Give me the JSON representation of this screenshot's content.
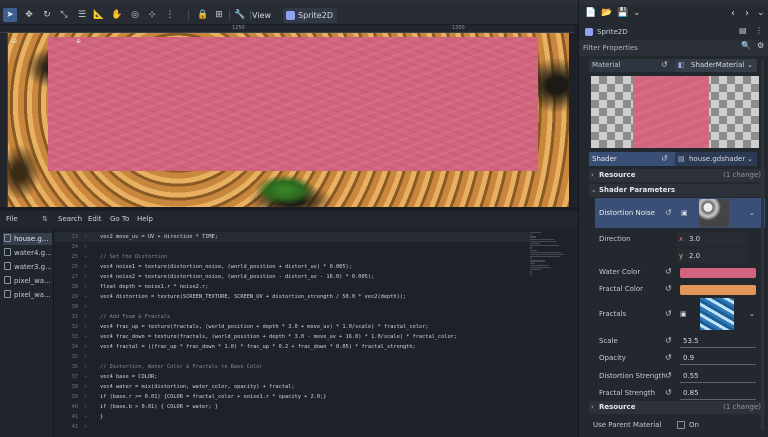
{
  "top_strip": {
    "tabs": [
      "",
      "",
      "",
      ""
    ]
  },
  "toolbar": {
    "view_label": "View",
    "node_chip": "Sprite2D"
  },
  "viewport": {
    "ruler_marks": [
      "1250",
      "1300"
    ]
  },
  "script_menu": {
    "items": [
      "File",
      "Search",
      "Edit",
      "Go To",
      "Help"
    ]
  },
  "files": [
    {
      "name": "house.g...",
      "selected": true
    },
    {
      "name": "water4.g..."
    },
    {
      "name": "water3.g..."
    },
    {
      "name": "pixel_wa..."
    },
    {
      "name": "pixel_wa..."
    }
  ],
  "code_lines": [
    {
      "n": "23",
      "text": "vec2 move_uv = UV + direction * TIME;",
      "hl": true
    },
    {
      "n": "24",
      "text": ""
    },
    {
      "n": "25",
      "text": "// Set the Distortion",
      "cmt": true
    },
    {
      "n": "26",
      "text": "vec4 noise1 = texture(distortion_noise, (world_position + distort_uv) * 0.005);"
    },
    {
      "n": "27",
      "text": "vec4 noise2 = texture(distortion_noise, (world_position - distort_uv - 16.0) * 0.005);"
    },
    {
      "n": "28",
      "text": "float depth = noise1.r * noise2.r;"
    },
    {
      "n": "29",
      "text": "vec4 distortion = texture(SCREEN_TEXTURE, SCREEN_UV + distortion_strength / 50.0 * vec2(depth));"
    },
    {
      "n": "30",
      "text": ""
    },
    {
      "n": "31",
      "text": "// Add Foam & Fractals",
      "cmt": true
    },
    {
      "n": "32",
      "text": "vec4 frac_up = texture(fractals, (world_position + depth * 3.0 + move_uv) * 1.0/scale) * fractal_color;"
    },
    {
      "n": "33",
      "text": "vec4 frac_down = texture(fractals, (world_position + depth * 3.0 - move_uv + 16.0) * 1.0/scale) * fractal_color;"
    },
    {
      "n": "34",
      "text": "vec4 fractal = ((frac_up * frac_down * 1.0) * frac_up * 0.2 + frac_down * 0.05) * fractal_strength;"
    },
    {
      "n": "35",
      "text": ""
    },
    {
      "n": "36",
      "text": "// Distortion, Water Color & Fractals to Base Color",
      "cmt": true
    },
    {
      "n": "37",
      "text": "vec4 base = COLOR;"
    },
    {
      "n": "38",
      "text": "vec4 water = mix(distortion, water_color, opacity) + fractal;"
    },
    {
      "n": "39",
      "text": "if (base.r >= 0.01) {COLOR = fractal_color + noise1.r * opacity + 2.0;}"
    },
    {
      "n": "40",
      "text": "if (base.b > 0.01) { COLOR = water; }"
    },
    {
      "n": "41",
      "text": "}"
    },
    {
      "n": "42",
      "text": ""
    }
  ],
  "inspector": {
    "node_name": "Sprite2D",
    "filter_placeholder": "Filter Properties",
    "material_label": "Material",
    "material_value": "ShaderMaterial",
    "shader_label": "Shader",
    "shader_value": "house.gdshader",
    "resource1": "Resource",
    "resource1_count": "(1 change)",
    "shader_params": "Shader Parameters",
    "distortion_noise": "Distortion Noise",
    "direction": "Direction",
    "dir_x_label": "x",
    "dir_x": "3.0",
    "dir_y_label": "y",
    "dir_y": "2.0",
    "water_color": "Water Color",
    "fractal_color": "Fractal Color",
    "fractals": "Fractals",
    "scale": "Scale",
    "scale_val": "53.5",
    "opacity": "Opacity",
    "opacity_val": "0.9",
    "distortion_strength": "Distortion Strength",
    "distortion_strength_val": "0.55",
    "fractal_strength": "Fractal Strength",
    "fractal_strength_val": "0.85",
    "resource2": "Resource",
    "resource2_count": "(1 change)",
    "use_parent": "Use Parent Material",
    "use_parent_val": "On"
  },
  "colors": {
    "water": "#d2647d",
    "fractal": "#e4965a",
    "accent": "#3d5e8e"
  }
}
